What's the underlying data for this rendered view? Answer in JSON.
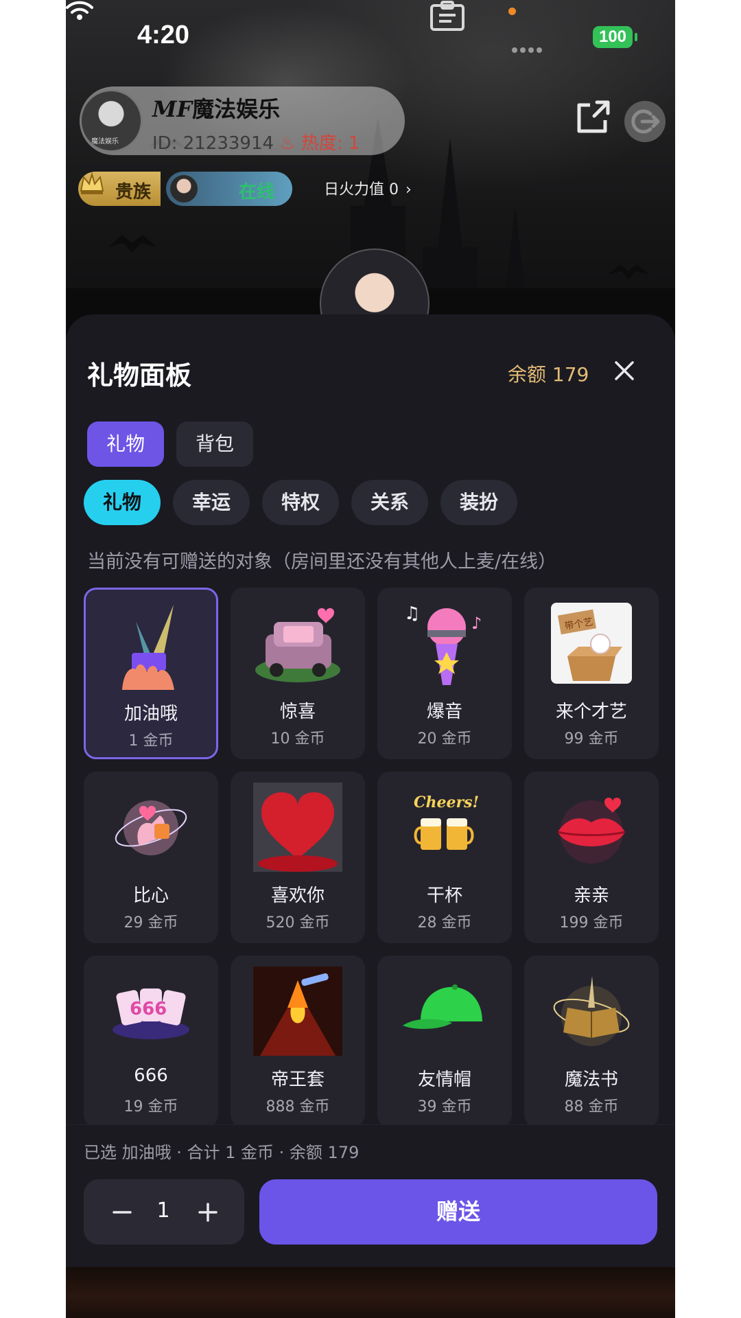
{
  "status_bar": {
    "time": "4:20",
    "battery": "100"
  },
  "room": {
    "name_prefix": "MF",
    "name": "魔法娱乐",
    "id_text": "ID: 21233914",
    "heat_text": "热度: 1",
    "noble_label": "贵族",
    "online_label": "在线",
    "fire_value": "日火力值 0",
    "avatar_tag": "魔法娱乐"
  },
  "panel": {
    "title": "礼物面板",
    "balance": "余额 179",
    "main_tabs": [
      {
        "label": "礼物",
        "active": true
      },
      {
        "label": "背包",
        "active": false
      }
    ],
    "category_tabs": [
      {
        "label": "礼物",
        "active": true
      },
      {
        "label": "幸运",
        "active": false
      },
      {
        "label": "特权",
        "active": false
      },
      {
        "label": "关系",
        "active": false
      },
      {
        "label": "装扮",
        "active": false
      }
    ],
    "notice": "当前没有可赠送的对象（房间里还没有其他人上麦/在线）",
    "gifts": [
      {
        "name": "加油哦",
        "price": "1 金币",
        "icon": "cheer-gift-icon",
        "selected": true
      },
      {
        "name": "惊喜",
        "price": "10 金币",
        "icon": "surprise-car-icon",
        "selected": false
      },
      {
        "name": "爆音",
        "price": "20 金币",
        "icon": "microphone-icon",
        "selected": false
      },
      {
        "name": "来个才艺",
        "price": "99 金币",
        "icon": "talent-box-icon",
        "selected": false
      },
      {
        "name": "比心",
        "price": "29 金币",
        "icon": "finger-heart-icon",
        "selected": false
      },
      {
        "name": "喜欢你",
        "price": "520 金币",
        "icon": "heart-icon",
        "selected": false
      },
      {
        "name": "干杯",
        "price": "28 金币",
        "icon": "cheers-beer-icon",
        "selected": false
      },
      {
        "name": "亲亲",
        "price": "199 金币",
        "icon": "kiss-lips-icon",
        "selected": false
      },
      {
        "name": "666",
        "price": "19 金币",
        "icon": "666-cards-icon",
        "selected": false
      },
      {
        "name": "帝王套",
        "price": "888 金币",
        "icon": "volcano-icon",
        "selected": false
      },
      {
        "name": "友情帽",
        "price": "39 金币",
        "icon": "green-cap-icon",
        "selected": false
      },
      {
        "name": "魔法书",
        "price": "88 金币",
        "icon": "magic-book-icon",
        "selected": false
      }
    ],
    "cheers_text": "Cheers!",
    "talent_sign": "带个艺",
    "card_text": "666",
    "footer": {
      "summary": "已选 加油哦 · 合计 1 金币 · 余额 179",
      "quantity": "1",
      "send_label": "赠送"
    }
  },
  "colors": {
    "accent": "#6b55e8",
    "category_active": "#27cfef",
    "balance": "#e4bc76",
    "panel_bg": "#1b1a21",
    "card_bg": "#25242d"
  }
}
